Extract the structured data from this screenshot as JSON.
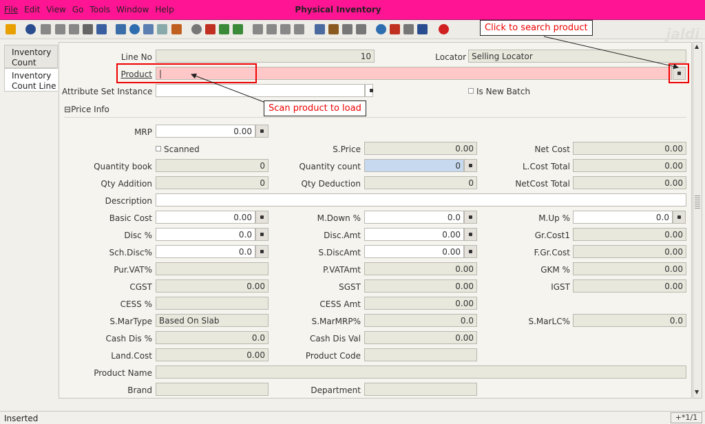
{
  "menu": {
    "file": "File",
    "edit": "Edit",
    "view": "View",
    "go": "Go",
    "tools": "Tools",
    "window": "Window",
    "help": "Help"
  },
  "window_title": "Physical Inventory",
  "logo_text": "jaldi",
  "tabs": [
    "Inventory Count",
    "Inventory Count Line"
  ],
  "form": {
    "line_no_label": "Line No",
    "line_no": "10",
    "locator_label": "Locator",
    "locator": "Selling Locator",
    "product_label": "Product",
    "product": "|",
    "attr_label": "Attribute Set Instance",
    "attr": "",
    "is_new_batch": "Is New Batch",
    "price_info": "Price Info",
    "mrp_label": "MRP",
    "mrp": "0.00",
    "scanned": "Scanned",
    "sprice_label": "S.Price",
    "sprice": "0.00",
    "net_cost_label": "Net Cost",
    "net_cost": "0.00",
    "qty_book_label": "Quantity book",
    "qty_book": "0",
    "qty_count_label": "Quantity count",
    "qty_count": "0",
    "lcost_total_label": "L.Cost Total",
    "lcost_total": "0.00",
    "qty_add_label": "Qty Addition",
    "qty_add": "0",
    "qty_ded_label": "Qty Deduction",
    "qty_ded": "0",
    "netcost_total_label": "NetCost Total",
    "netcost_total": "0.00",
    "desc_label": "Description",
    "desc": "",
    "basic_cost_label": "Basic Cost",
    "basic_cost": "0.00",
    "mdown_label": "M.Down %",
    "mdown": "0.0",
    "mup_label": "M.Up %",
    "mup": "0.0",
    "disc_label": "Disc %",
    "disc": "0.0",
    "disc_amt_label": "Disc.Amt",
    "disc_amt": "0.00",
    "grcost1_label": "Gr.Cost1",
    "grcost1": "0.00",
    "sch_disc_label": "Sch.Disc%",
    "sch_disc": "0.0",
    "sdisc_amt_label": "S.DiscAmt",
    "sdisc_amt": "0.00",
    "fgrcost_label": "F.Gr.Cost",
    "fgrcost": "0.00",
    "pur_vat_label": "Pur.VAT%",
    "pur_vat": "",
    "pvat_amt_label": "P.VATAmt",
    "pvat_amt": "0.00",
    "gkm_label": "GKM %",
    "gkm": "0.00",
    "cgst_label": "CGST",
    "cgst": "0.00",
    "sgst_label": "SGST",
    "sgst": "0.00",
    "igst_label": "IGST",
    "igst": "0.00",
    "cess_label": "CESS %",
    "cess": "",
    "cess_amt_label": "CESS Amt",
    "cess_amt": "0.00",
    "smartype_label": "S.MarType",
    "smartype": "Based On Slab",
    "smarmrp_label": "S.MarMRP%",
    "smarmrp": "0.0",
    "smarlc_label": "S.MarLC%",
    "smarlc": "0.0",
    "cash_dis_label": "Cash Dis %",
    "cash_dis": "0.0",
    "cash_dis_val_label": "Cash Dis Val",
    "cash_dis_val": "0.00",
    "land_cost_label": "Land.Cost",
    "land_cost": "0.00",
    "product_code_label": "Product Code",
    "product_code": "",
    "product_name_label": "Product Name",
    "product_name": "",
    "brand_label": "Brand",
    "brand": "",
    "department_label": "Department",
    "department": ""
  },
  "annotations": {
    "search": "Click to search product",
    "scan": "Scan product to load"
  },
  "status": {
    "text": "Inserted",
    "record": "+*1/1"
  }
}
